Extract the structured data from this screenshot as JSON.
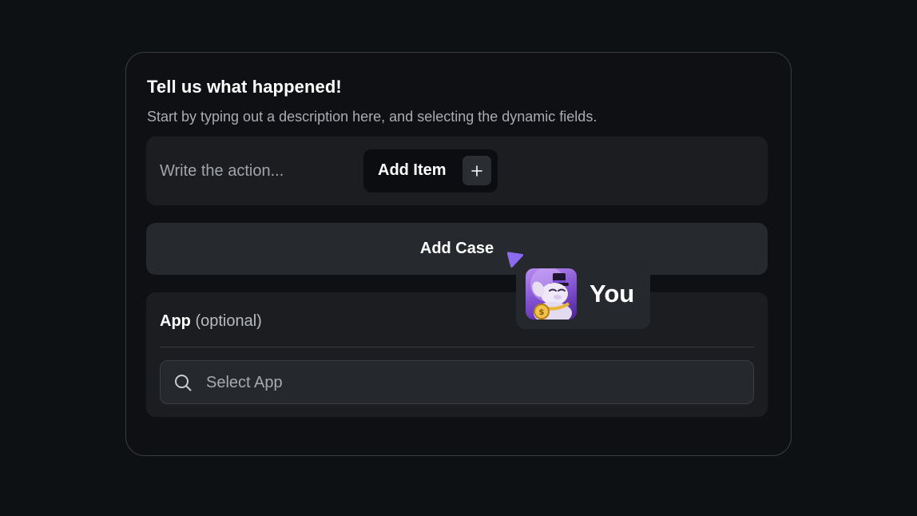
{
  "form": {
    "title": "Tell us what happened!",
    "subtitle": "Start by typing out a description here, and selecting the dynamic fields.",
    "action_placeholder": "Write the action...",
    "add_item_label": "Add Item",
    "add_case_label": "Add Case",
    "app_label": "App",
    "app_optional": "(optional)",
    "select_app_placeholder": "Select App"
  },
  "presence": {
    "user_label": "You",
    "avatar_icon": "avatar-image",
    "cursor_color": "#8b6cf0"
  },
  "icons": {
    "plus": "plus-icon",
    "search": "search-icon",
    "cursor": "pointer-cursor-icon"
  },
  "colors": {
    "background": "#0e1114",
    "card": "#0f1013",
    "panel": "#1b1d21",
    "button": "#262a2e",
    "accent": "#8b6cf0"
  }
}
